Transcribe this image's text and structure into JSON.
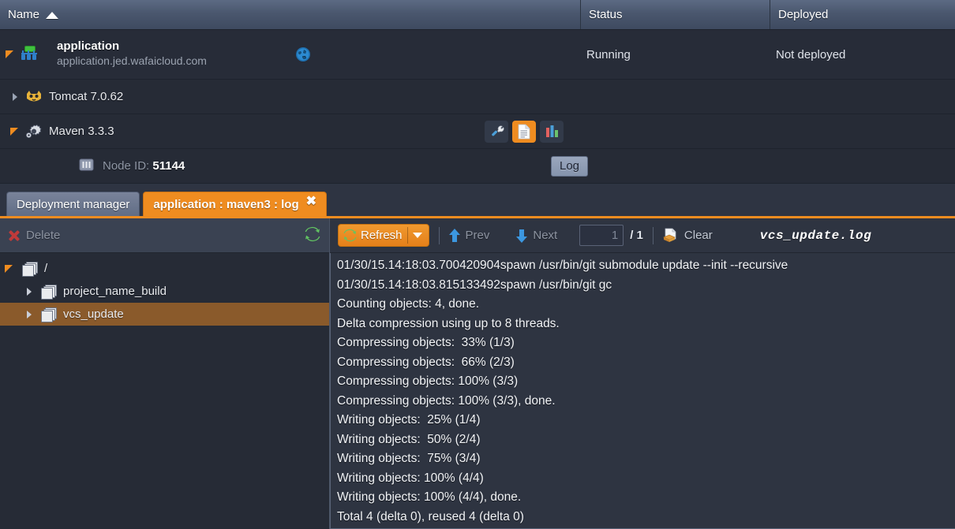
{
  "grid": {
    "columns": [
      {
        "key": "name",
        "label": "Name",
        "sort": "asc"
      },
      {
        "key": "status",
        "label": "Status"
      },
      {
        "key": "deployed",
        "label": "Deployed"
      }
    ],
    "rows": [
      {
        "type": "environment",
        "icon": "environment-icon",
        "title": "application",
        "host": "application.jed.wafaicloud.com",
        "status": "Running",
        "deployed": "Not deployed",
        "expanded": true,
        "extra_icon": "globe-icon"
      },
      {
        "type": "node",
        "icon": "tomcat-icon",
        "label": "Tomcat 7.0.62",
        "expanded": false
      },
      {
        "type": "node",
        "icon": "maven-gear-icon",
        "label": "Maven 3.3.3",
        "expanded": true,
        "actions": [
          {
            "name": "config-icon",
            "label": "Config",
            "highlighted": false
          },
          {
            "name": "log-file-icon",
            "label": "Log",
            "highlighted": true
          },
          {
            "name": "statistics-icon",
            "label": "Statistics",
            "highlighted": false
          }
        ]
      },
      {
        "type": "subnode",
        "icon": "node-id-icon",
        "label_prefix": "Node ID: ",
        "label_value": "51144",
        "tooltip": "Log"
      }
    ]
  },
  "tabs": [
    {
      "label": "Deployment manager",
      "active": false,
      "closable": false
    },
    {
      "label": "application : maven3 : log",
      "active": true,
      "closable": true,
      "close_glyph": "✖"
    }
  ],
  "left_toolbar": {
    "delete_label": "Delete",
    "delete_icon": "delete-x-icon",
    "refresh_icon": "refresh-icon"
  },
  "file_tree": [
    {
      "label": "/",
      "icon": "folder-stack-icon",
      "expanded": true,
      "indent": 0,
      "selected": false
    },
    {
      "label": "project_name_build",
      "icon": "folder-stack-icon",
      "expanded": false,
      "indent": 1,
      "selected": false
    },
    {
      "label": "vcs_update",
      "icon": "folder-stack-icon",
      "expanded": false,
      "indent": 1,
      "selected": true
    }
  ],
  "log_toolbar": {
    "refresh_label": "Refresh",
    "refresh_icon": "refresh-icon",
    "dropdown_icon": "chevron-down-icon",
    "prev_label": "Prev",
    "prev_icon": "arrow-up-icon",
    "next_label": "Next",
    "next_icon": "arrow-down-icon",
    "page_value": "1",
    "page_total": "/ 1",
    "clear_label": "Clear",
    "clear_icon": "clear-icon",
    "filename": "vcs_update.log"
  },
  "log_lines": [
    "01/30/15.14:18:03.700420904spawn /usr/bin/git submodule update --init --recursive",
    "01/30/15.14:18:03.815133492spawn /usr/bin/git gc",
    "Counting objects: 4, done.",
    "Delta compression using up to 8 threads.",
    "Compressing objects:  33% (1/3)",
    "Compressing objects:  66% (2/3)",
    "Compressing objects: 100% (3/3)",
    "Compressing objects: 100% (3/3), done.",
    "Writing objects:  25% (1/4)",
    "Writing objects:  50% (2/4)",
    "Writing objects:  75% (3/4)",
    "Writing objects: 100% (4/4)",
    "Writing objects: 100% (4/4), done.",
    "Total 4 (delta 0), reused 4 (delta 0)"
  ],
  "colors": {
    "accent": "#ef8c20",
    "selection": "#8a5a2b",
    "background": "#262b36",
    "header": "#4a576e",
    "panel": "#2e3441"
  }
}
